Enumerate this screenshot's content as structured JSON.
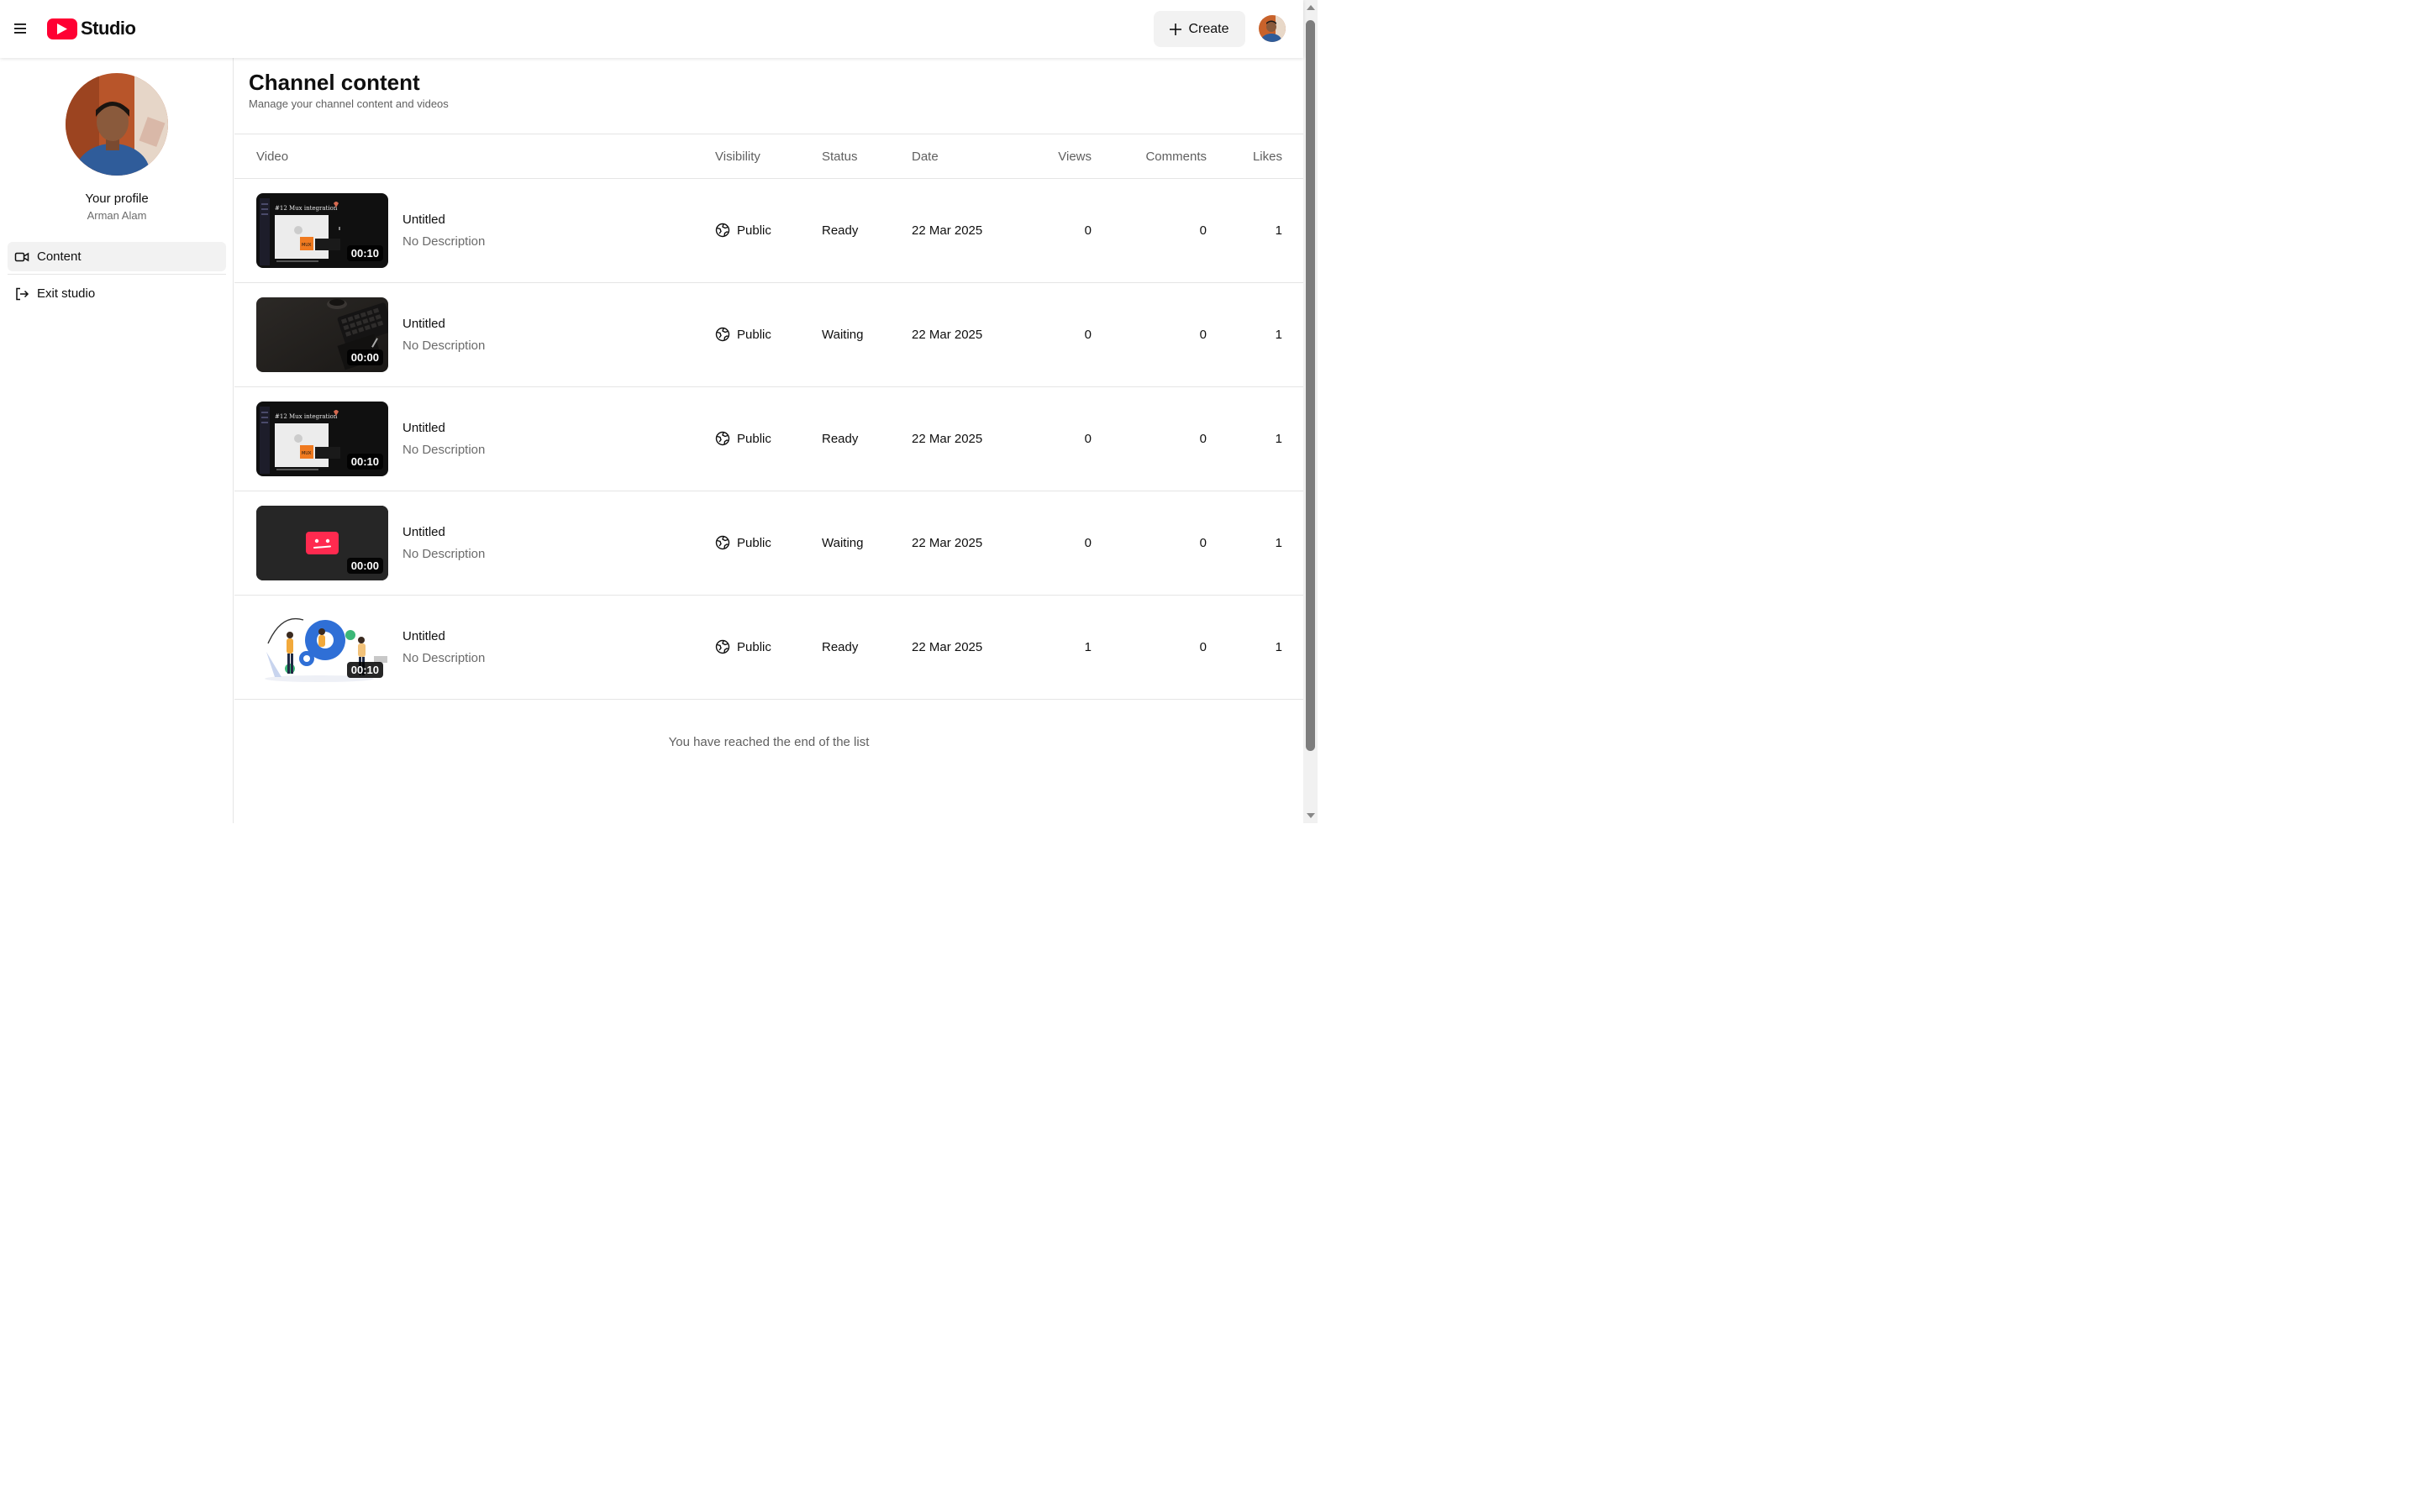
{
  "header": {
    "logo_text": "Studio",
    "create_label": "Create"
  },
  "sidebar": {
    "profile_title": "Your profile",
    "profile_name": "Arman Alam",
    "items": [
      {
        "label": "Content",
        "icon": "video-camera-icon",
        "active": true
      },
      {
        "label": "Exit studio",
        "icon": "log-out-icon",
        "active": false
      }
    ]
  },
  "page": {
    "title": "Channel content",
    "subtitle": "Manage your channel content and videos"
  },
  "table": {
    "columns": [
      "Video",
      "Visibility",
      "Status",
      "Date",
      "Views",
      "Comments",
      "Likes"
    ],
    "rows": [
      {
        "title": "Untitled",
        "description": "No Description",
        "duration": "00:10",
        "visibility": "Public",
        "status": "Ready",
        "date": "22 Mar 2025",
        "views": "0",
        "comments": "0",
        "likes": "1",
        "thumb": "mux"
      },
      {
        "title": "Untitled",
        "description": "No Description",
        "duration": "00:00",
        "visibility": "Public",
        "status": "Waiting",
        "date": "22 Mar 2025",
        "views": "0",
        "comments": "0",
        "likes": "1",
        "thumb": "desk"
      },
      {
        "title": "Untitled",
        "description": "No Description",
        "duration": "00:10",
        "visibility": "Public",
        "status": "Ready",
        "date": "22 Mar 2025",
        "views": "0",
        "comments": "0",
        "likes": "1",
        "thumb": "mux"
      },
      {
        "title": "Untitled",
        "description": "No Description",
        "duration": "00:00",
        "visibility": "Public",
        "status": "Waiting",
        "date": "22 Mar 2025",
        "views": "0",
        "comments": "0",
        "likes": "1",
        "thumb": "placeholder"
      },
      {
        "title": "Untitled",
        "description": "No Description",
        "duration": "00:10",
        "visibility": "Public",
        "status": "Ready",
        "date": "22 Mar 2025",
        "views": "1",
        "comments": "0",
        "likes": "1",
        "thumb": "illustration"
      }
    ],
    "end_message": "You have reached the end of the list"
  },
  "colors": {
    "brand": "#ff0033",
    "active_nav_bg": "#f2f2f2"
  }
}
